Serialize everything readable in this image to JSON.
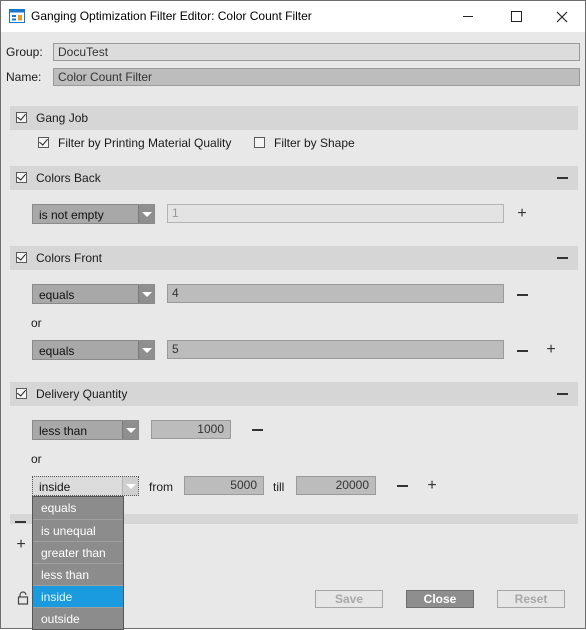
{
  "window": {
    "title": "Ganging Optimization Filter Editor: Color Count Filter"
  },
  "form": {
    "group_label": "Group:",
    "group_value": "DocuTest",
    "name_label": "Name:",
    "name_value": "Color Count Filter"
  },
  "gang_job": {
    "label": "Gang Job",
    "checked": true,
    "opt_quality": "Filter by Printing Material Quality",
    "opt_quality_checked": true,
    "opt_shape": "Filter by Shape",
    "opt_shape_checked": false
  },
  "colors_back": {
    "label": "Colors Back",
    "checked": true,
    "condition": "is not empty",
    "value": "1"
  },
  "colors_front": {
    "label": "Colors Front",
    "checked": true,
    "or": "or",
    "rows": [
      {
        "condition": "equals",
        "value": "4"
      },
      {
        "condition": "equals",
        "value": "5"
      }
    ]
  },
  "delivery_quantity": {
    "label": "Delivery Quantity",
    "checked": true,
    "or": "or",
    "row1": {
      "condition": "less than",
      "value": "1000"
    },
    "row2": {
      "condition": "inside",
      "from_label": "from",
      "from_value": "5000",
      "till_label": "till",
      "till_value": "20000"
    }
  },
  "dropdown": {
    "options": [
      "equals",
      "is unequal",
      "greater than",
      "less than",
      "inside",
      "outside"
    ],
    "selected": "inside"
  },
  "buttons": {
    "save": "Save",
    "close": "Close",
    "reset": "Reset"
  },
  "icons": {
    "app": "filter-editor-icon",
    "lock": "lock-icon",
    "add": "plus-icon",
    "remove": "minus-icon"
  },
  "colors": {
    "selection": "#1a9be0",
    "section_bar": "#d6d6d6",
    "window_bg": "#e8e8e8"
  }
}
